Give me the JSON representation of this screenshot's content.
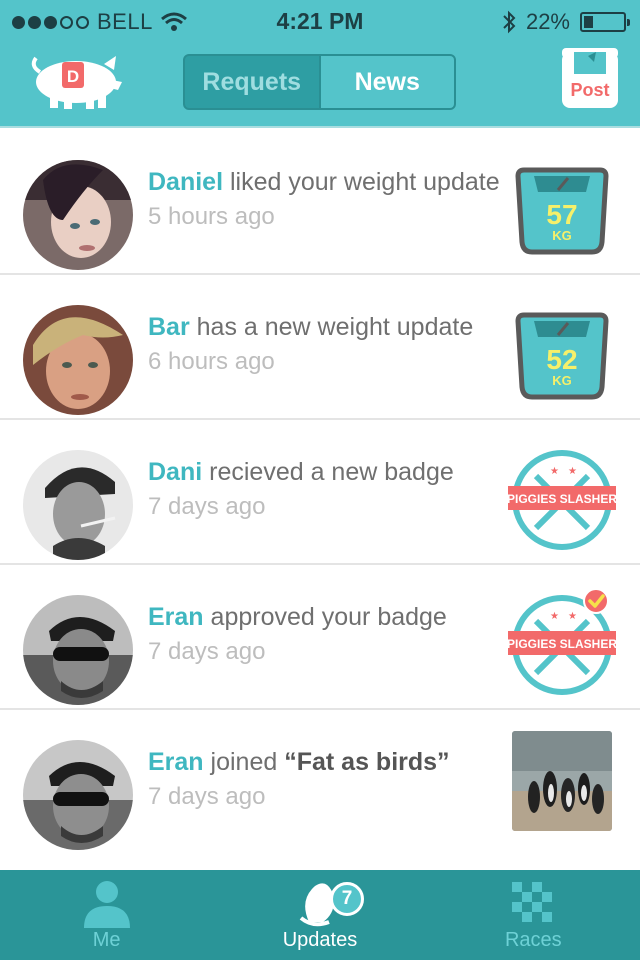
{
  "status_bar": {
    "carrier": "BELL",
    "time": "4:21 PM",
    "battery": "22%",
    "battery_level": 0.22,
    "signal_bars": 3
  },
  "header": {
    "logo_letter": "D",
    "tabs": [
      {
        "label": "Requets",
        "active": false
      },
      {
        "label": "News",
        "active": true
      }
    ],
    "post_label": "Post"
  },
  "feed": [
    {
      "name": "Daniel",
      "action": "liked your weight update",
      "time": "5 hours ago",
      "thumbnail": "scale",
      "value": "57",
      "unit": "KG"
    },
    {
      "name": "Bar",
      "action": "has a new weight update",
      "time": "6 hours ago",
      "thumbnail": "scale",
      "value": "52",
      "unit": "KG"
    },
    {
      "name": "Dani",
      "action": "recieved a new badge",
      "time": "7 days ago",
      "thumbnail": "badge",
      "badge_text": "PIGGIES SLASHER"
    },
    {
      "name": "Eran",
      "action": "approved your badge",
      "time": "7 days ago",
      "thumbnail": "badge-approved",
      "badge_text": "PIGGIES SLASHER"
    },
    {
      "name": "Eran",
      "action": "joined",
      "group": "“Fat as birds”",
      "time": "7 days ago",
      "thumbnail": "photo"
    }
  ],
  "tabbar": {
    "tabs": [
      {
        "label": "Me",
        "icon": "person-icon",
        "active": false
      },
      {
        "label": "Updates",
        "icon": "egg-icon",
        "active": true,
        "badge": "7"
      },
      {
        "label": "Races",
        "icon": "checkered-flag-icon",
        "active": false
      }
    ]
  },
  "colors": {
    "accent": "#54c4ca",
    "tabbar": "#2a9598",
    "name": "#3fb7c0",
    "badge_red": "#f26a6a",
    "scale_yellow": "#f6f06a"
  }
}
